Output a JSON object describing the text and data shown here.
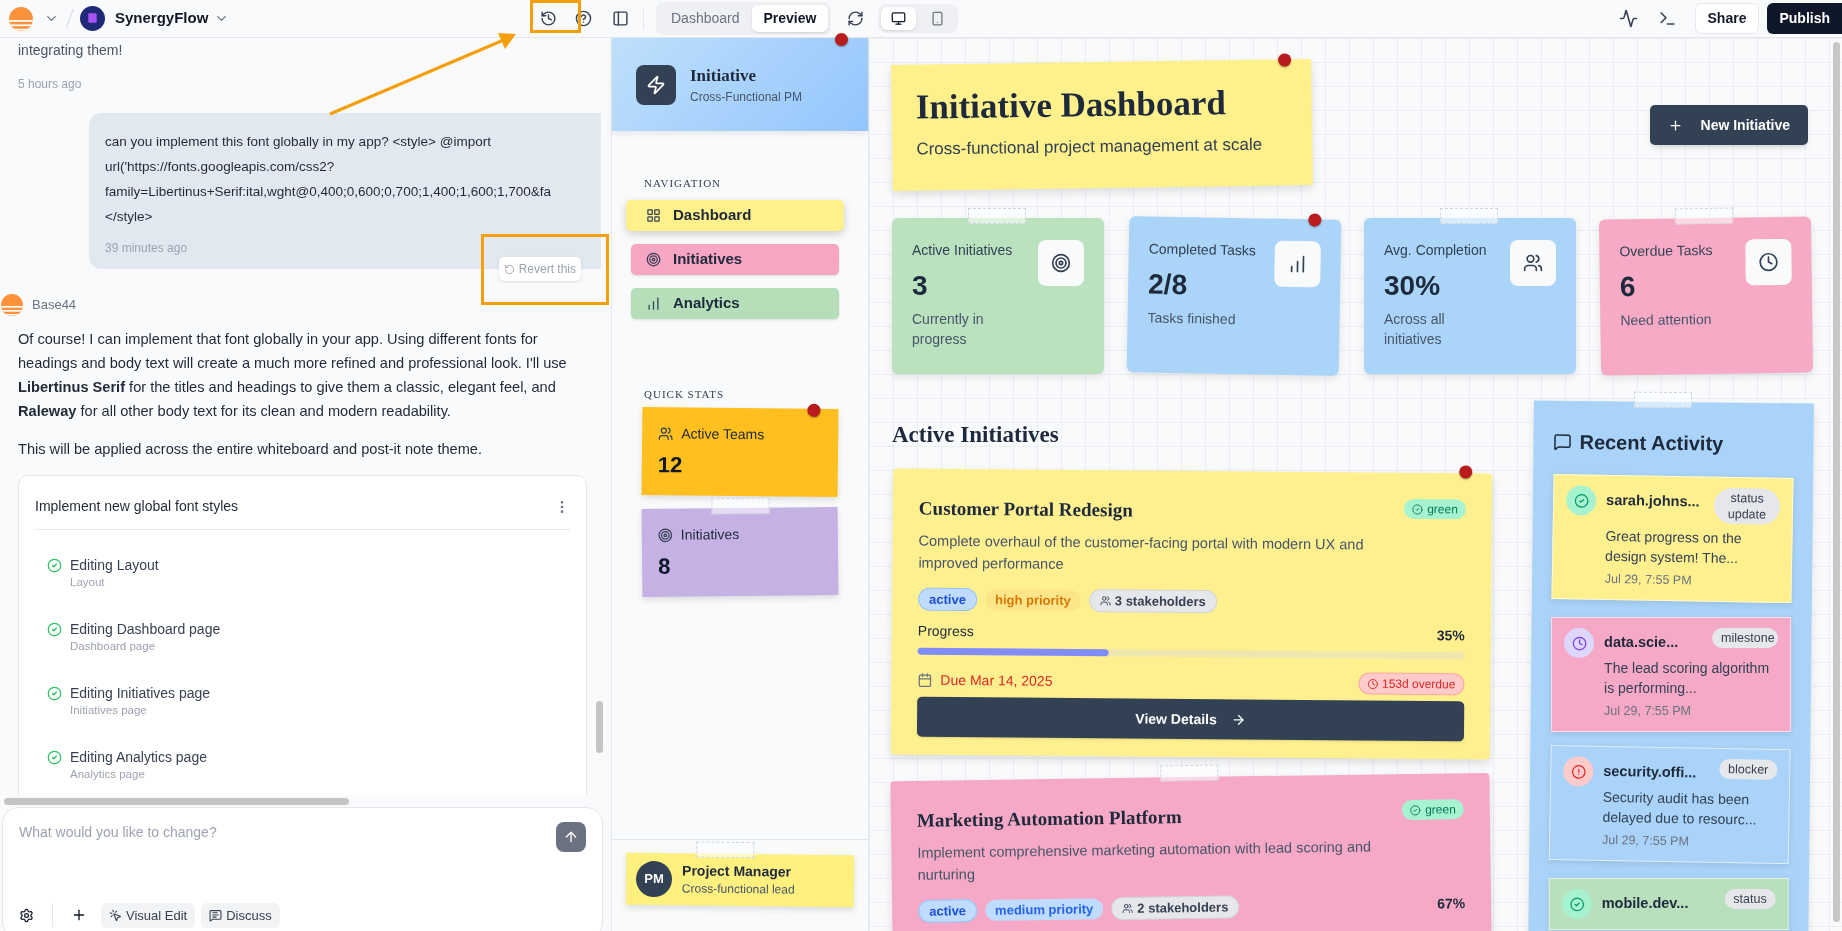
{
  "top_bar": {
    "project": "SynergyFlow",
    "view_tabs": [
      {
        "label": "Dashboard",
        "selected": false
      },
      {
        "label": "Preview",
        "selected": true
      }
    ],
    "devices": [
      {
        "kind": "desktop",
        "selected": true
      },
      {
        "kind": "mobile",
        "selected": false
      }
    ],
    "share": "Share",
    "publish": "Publish"
  },
  "chat": {
    "earlier": {
      "text": "integrating them!",
      "time": "5 hours ago"
    },
    "user_message": {
      "lines": [
        "can you implement this font globally in my app? <style> @import",
        "url('https://fonts.googleapis.com/css2?",
        "family=Libertinus+Serif:ital,wght@0,400;0,600;0,700;1,400;1,600;1,700&fa",
        "</style>"
      ],
      "time": "39 minutes ago",
      "revert": "Revert this"
    },
    "reply": {
      "author": "Base44",
      "paragraphs": [
        "Of course! I can implement that font globally in your app. Using different fonts for headings and body text will create a much more refined and professional look. I'll use **Libertinus Serif** for the titles and headings to give them a classic, elegant feel, and **Raleway** for all other body text for its clean and modern readability.",
        "This will be applied across the entire whiteboard and post-it note theme."
      ]
    },
    "task_card": {
      "title": "Implement new global font styles",
      "items": [
        {
          "title": "Editing Layout",
          "subtitle": "Layout",
          "done": true
        },
        {
          "title": "Editing Dashboard page",
          "subtitle": "Dashboard page",
          "done": true
        },
        {
          "title": "Editing Initiatives page",
          "subtitle": "Initiatives page",
          "done": true
        },
        {
          "title": "Editing Analytics page",
          "subtitle": "Analytics page",
          "done": true
        }
      ]
    },
    "input": {
      "placeholder": "What would you like to change?",
      "actions": [
        "Visual Edit",
        "Discuss"
      ]
    }
  },
  "app": {
    "sidebar": {
      "brand": {
        "title": "Initiative",
        "subtitle": "Cross-Functional PM"
      },
      "nav_heading": "NAVIGATION",
      "nav": [
        {
          "label": "Dashboard",
          "kind": "grid",
          "color": "#fef08a",
          "selected": true
        },
        {
          "label": "Initiatives",
          "kind": "target",
          "color": "#f6a5c3",
          "selected": false
        },
        {
          "label": "Analytics",
          "kind": "chart",
          "color": "#b4dfb8",
          "selected": false
        }
      ],
      "stats_heading": "QUICK STATS",
      "quick_stats": [
        {
          "label": "Active Teams",
          "value": "12",
          "kind": "users",
          "color": "#ffbf1f"
        },
        {
          "label": "Initiatives",
          "value": "8",
          "kind": "target",
          "color": "#c5b1e4"
        }
      ],
      "profile": {
        "initials": "PM",
        "name": "Project Manager",
        "role": "Cross-functional lead"
      }
    },
    "header": {
      "title": "Initiative Dashboard",
      "subtitle": "Cross-functional project management at scale",
      "new_button": "New Initiative"
    },
    "stats": [
      {
        "label": "Active Initiatives",
        "value": "3",
        "caption": "Currently in progress",
        "kind": "target",
        "color": "#bbe2bf"
      },
      {
        "label": "Completed Tasks",
        "value": "2/8",
        "caption": "Tasks finished",
        "kind": "chart",
        "color": "#aad4f8"
      },
      {
        "label": "Avg. Completion",
        "value": "30%",
        "caption": "Across all initiatives",
        "kind": "users",
        "color": "#aad4f8"
      },
      {
        "label": "Overdue Tasks",
        "value": "6",
        "caption": "Need attention",
        "kind": "clock",
        "color": "#f6aac6"
      }
    ],
    "section_title": "Active Initiatives",
    "initiatives": [
      {
        "title": "Customer Portal Redesign",
        "health": "green",
        "description": "Complete overhaul of the customer-facing portal with modern UX and improved performance",
        "color": "#fff08f",
        "tags": [
          {
            "label": "active",
            "kind": "status"
          },
          {
            "label": "high priority",
            "kind": "high"
          },
          {
            "label": "3 stakeholders",
            "kind": "stakeholders"
          }
        ],
        "progress_label": "Progress",
        "progress_value": "35%",
        "level": 0.35,
        "due": "Due Mar 14, 2025",
        "overdue": "153d overdue",
        "button": "View Details"
      },
      {
        "title": "Marketing Automation Platform",
        "health": "green",
        "description": "Implement comprehensive marketing automation with lead scoring and nurturing",
        "color": "#f6a9c6",
        "tags": [
          {
            "label": "active",
            "kind": "status"
          },
          {
            "label": "medium priority",
            "kind": "medium"
          },
          {
            "label": "2 stakeholders",
            "kind": "stakeholders"
          }
        ],
        "progress_value": "67%"
      }
    ],
    "activity": {
      "title": "Recent Activity",
      "items": [
        {
          "user": "sarah.johns...",
          "badge": "status update",
          "text": "Great progress on the design system! The...",
          "time": "Jul 29, 7:55 PM",
          "kind": "check",
          "color": "#fff08f"
        },
        {
          "user": "data.scie...",
          "badge": "milestone",
          "text": "The lead scoring algorithm is performing...",
          "time": "Jul 29, 7:55 PM",
          "kind": "clock",
          "color": "#f6a9c6"
        },
        {
          "user": "security.offi...",
          "badge": "blocker",
          "text": "Security audit has been delayed due to resourc...",
          "time": "Jul 29, 7:55 PM",
          "kind": "alert",
          "color": "#a9d3f8"
        },
        {
          "user": "mobile.dev...",
          "badge": "status",
          "kind": "check",
          "color": "#b9e0bd"
        }
      ]
    }
  }
}
